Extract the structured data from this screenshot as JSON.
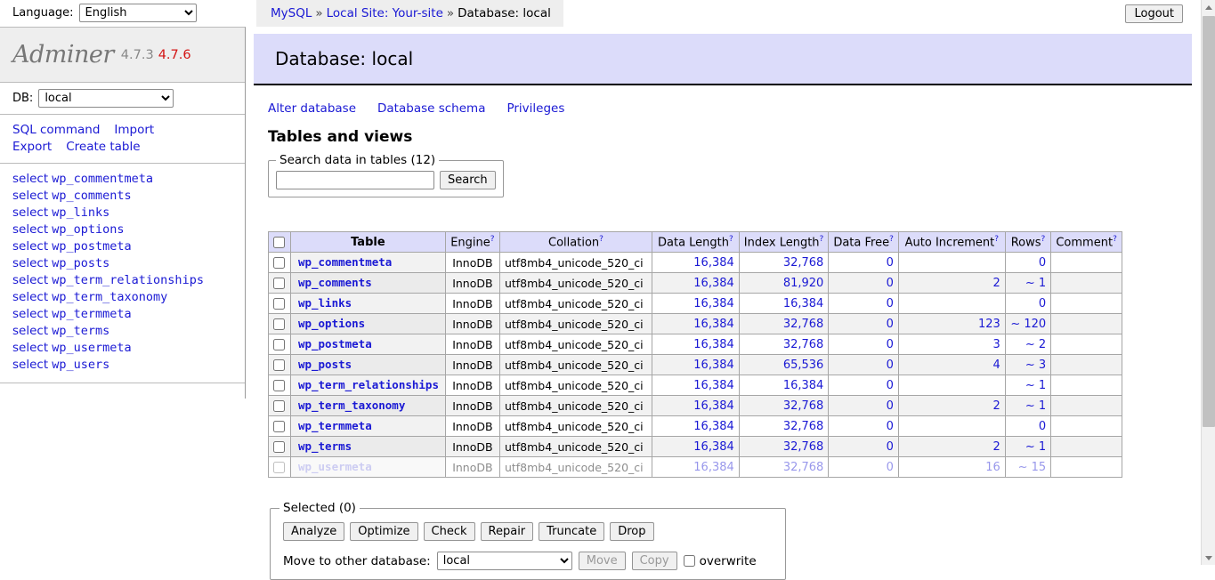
{
  "topbar": {
    "language_label": "Language:",
    "language_value": "English",
    "language_options": [
      "English"
    ],
    "logout_label": "Logout",
    "breadcrumb": {
      "server": "MySQL",
      "separator": "»",
      "site": "Local Site: Your-site",
      "database": "Database: local"
    }
  },
  "sidebar": {
    "logo_name": "Adminer",
    "version": "4.7.3",
    "new_version": "4.7.6",
    "db_label": "DB:",
    "db_value": "local",
    "db_options": [
      "local"
    ],
    "menu_links": [
      {
        "label": "SQL command"
      },
      {
        "label": "Import"
      },
      {
        "label": "Export"
      },
      {
        "label": "Create table"
      }
    ],
    "select_prefix": "select",
    "table_links": [
      "wp_commentmeta",
      "wp_comments",
      "wp_links",
      "wp_options",
      "wp_postmeta",
      "wp_posts",
      "wp_term_relationships",
      "wp_term_taxonomy",
      "wp_termmeta",
      "wp_terms",
      "wp_usermeta",
      "wp_users"
    ]
  },
  "main": {
    "page_title": "Database: local",
    "db_actions": [
      {
        "label": "Alter database"
      },
      {
        "label": "Database schema"
      },
      {
        "label": "Privileges"
      }
    ],
    "section_title": "Tables and views",
    "search": {
      "legend": "Search data in tables (12)",
      "value": "",
      "placeholder": "",
      "button_label": "Search"
    },
    "table": {
      "columns": [
        {
          "label": "",
          "help": false,
          "key": "checkbox"
        },
        {
          "label": "Table",
          "help": false,
          "key": "table"
        },
        {
          "label": "Engine",
          "help": true,
          "key": "engine"
        },
        {
          "label": "Collation",
          "help": true,
          "key": "collation"
        },
        {
          "label": "Data Length",
          "help": true,
          "key": "data_length"
        },
        {
          "label": "Index Length",
          "help": true,
          "key": "index_length"
        },
        {
          "label": "Data Free",
          "help": true,
          "key": "data_free"
        },
        {
          "label": "Auto Increment",
          "help": true,
          "key": "auto_increment"
        },
        {
          "label": "Rows",
          "help": true,
          "key": "rows"
        },
        {
          "label": "Comment",
          "help": true,
          "key": "comment"
        }
      ],
      "help_marker": "?",
      "rows": [
        {
          "table": "wp_commentmeta",
          "engine": "InnoDB",
          "collation": "utf8mb4_unicode_520_ci",
          "data_length": "16,384",
          "index_length": "32,768",
          "data_free": "0",
          "auto_increment": "",
          "rows": "0",
          "comment": ""
        },
        {
          "table": "wp_comments",
          "engine": "InnoDB",
          "collation": "utf8mb4_unicode_520_ci",
          "data_length": "16,384",
          "index_length": "81,920",
          "data_free": "0",
          "auto_increment": "2",
          "rows": "~ 1",
          "comment": ""
        },
        {
          "table": "wp_links",
          "engine": "InnoDB",
          "collation": "utf8mb4_unicode_520_ci",
          "data_length": "16,384",
          "index_length": "16,384",
          "data_free": "0",
          "auto_increment": "",
          "rows": "0",
          "comment": ""
        },
        {
          "table": "wp_options",
          "engine": "InnoDB",
          "collation": "utf8mb4_unicode_520_ci",
          "data_length": "16,384",
          "index_length": "32,768",
          "data_free": "0",
          "auto_increment": "123",
          "rows": "~ 120",
          "comment": ""
        },
        {
          "table": "wp_postmeta",
          "engine": "InnoDB",
          "collation": "utf8mb4_unicode_520_ci",
          "data_length": "16,384",
          "index_length": "32,768",
          "data_free": "0",
          "auto_increment": "3",
          "rows": "~ 2",
          "comment": ""
        },
        {
          "table": "wp_posts",
          "engine": "InnoDB",
          "collation": "utf8mb4_unicode_520_ci",
          "data_length": "16,384",
          "index_length": "65,536",
          "data_free": "0",
          "auto_increment": "4",
          "rows": "~ 3",
          "comment": ""
        },
        {
          "table": "wp_term_relationships",
          "engine": "InnoDB",
          "collation": "utf8mb4_unicode_520_ci",
          "data_length": "16,384",
          "index_length": "16,384",
          "data_free": "0",
          "auto_increment": "",
          "rows": "~ 1",
          "comment": ""
        },
        {
          "table": "wp_term_taxonomy",
          "engine": "InnoDB",
          "collation": "utf8mb4_unicode_520_ci",
          "data_length": "16,384",
          "index_length": "32,768",
          "data_free": "0",
          "auto_increment": "2",
          "rows": "~ 1",
          "comment": ""
        },
        {
          "table": "wp_termmeta",
          "engine": "InnoDB",
          "collation": "utf8mb4_unicode_520_ci",
          "data_length": "16,384",
          "index_length": "32,768",
          "data_free": "0",
          "auto_increment": "",
          "rows": "0",
          "comment": ""
        },
        {
          "table": "wp_terms",
          "engine": "InnoDB",
          "collation": "utf8mb4_unicode_520_ci",
          "data_length": "16,384",
          "index_length": "32,768",
          "data_free": "0",
          "auto_increment": "2",
          "rows": "~ 1",
          "comment": ""
        },
        {
          "table": "wp_usermeta",
          "engine": "InnoDB",
          "collation": "utf8mb4_unicode_520_ci",
          "data_length": "16,384",
          "index_length": "32,768",
          "data_free": "0",
          "auto_increment": "16",
          "rows": "~ 15",
          "comment": ""
        }
      ]
    },
    "selected": {
      "legend": "Selected (0)",
      "buttons": [
        {
          "label": "Analyze"
        },
        {
          "label": "Optimize"
        },
        {
          "label": "Check"
        },
        {
          "label": "Repair"
        },
        {
          "label": "Truncate"
        },
        {
          "label": "Drop"
        }
      ],
      "move_label": "Move to other database:",
      "move_db_value": "local",
      "move_db_options": [
        "local"
      ],
      "move_button": "Move",
      "copy_button": "Copy",
      "overwrite_label": "overwrite",
      "overwrite_checked": false
    }
  },
  "colors": {
    "link": "#1a19d4",
    "header_band": "#dcdcfa",
    "new_version": "#d41515",
    "row_alt": "#f2f2f2"
  }
}
